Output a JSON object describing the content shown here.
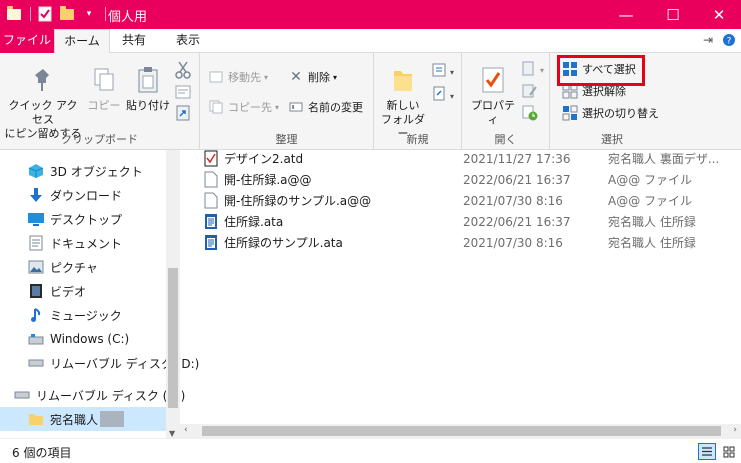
{
  "window": {
    "title": "個人用"
  },
  "quick_access": {
    "icons": [
      "folder-icon",
      "properties-check-icon",
      "new-folder-icon",
      "customize-dropdown-icon"
    ]
  },
  "title_buttons": {
    "minimize": "—",
    "maximize": "☐",
    "close": "✕"
  },
  "tabs": {
    "file": "ファイル",
    "home": "ホーム",
    "share": "共有",
    "view": "表示"
  },
  "ribbon": {
    "clipboard": {
      "label": "クリップボード",
      "pin_line1": "クイック アクセス",
      "pin_line2": "にピン留めする",
      "copy": "コピー",
      "paste": "貼り付け"
    },
    "organize": {
      "label": "整理",
      "move_to": "移動先",
      "copy_to": "コピー先",
      "delete": "削除",
      "rename": "名前の変更"
    },
    "new": {
      "label": "新規",
      "new_folder_line1": "新しい",
      "new_folder_line2": "フォルダー"
    },
    "open": {
      "label": "開く",
      "properties": "プロパティ"
    },
    "select": {
      "label": "選択",
      "select_all": "すべて選択",
      "select_none": "選択解除",
      "invert": "選択の切り替え"
    },
    "highlight_color": "#e6001a"
  },
  "nav": {
    "items": [
      {
        "label": "3D オブジェクト",
        "icon": "3d-objects-icon"
      },
      {
        "label": "ダウンロード",
        "icon": "download-icon"
      },
      {
        "label": "デスクトップ",
        "icon": "desktop-icon"
      },
      {
        "label": "ドキュメント",
        "icon": "documents-icon"
      },
      {
        "label": "ピクチャ",
        "icon": "pictures-icon"
      },
      {
        "label": "ビデオ",
        "icon": "video-icon"
      },
      {
        "label": "ミュージック",
        "icon": "music-icon"
      },
      {
        "label": "Windows (C:)",
        "icon": "windows-drive-icon"
      },
      {
        "label": "リムーバブル ディスク (D:)",
        "icon": "removable-drive-icon"
      },
      {
        "label": "リムーバブル ディスク (D:)",
        "icon": "removable-drive-icon"
      },
      {
        "label": "宛名職人",
        "icon": "folder-icon"
      }
    ]
  },
  "files": [
    {
      "name": "デザイン2.atd",
      "date": "2021/11/27 17:36",
      "type": "宛名職人 裏面デザ...",
      "icon": "atd-file-icon"
    },
    {
      "name": "開-住所録.a@@",
      "date": "2022/06/21 16:37",
      "type": "A@@ ファイル",
      "icon": "blank-file-icon"
    },
    {
      "name": "開-住所録のサンプル.a@@",
      "date": "2021/07/30 8:16",
      "type": "A@@ ファイル",
      "icon": "blank-file-icon"
    },
    {
      "name": "住所録.ata",
      "date": "2022/06/21 16:37",
      "type": "宛名職人 住所録",
      "icon": "ata-file-icon"
    },
    {
      "name": "住所録のサンプル.ata",
      "date": "2021/07/30 8:16",
      "type": "宛名職人 住所録",
      "icon": "ata-file-icon"
    }
  ],
  "status": {
    "item_count": "6 個の項目"
  },
  "colors": {
    "title_bar": "#e8005c",
    "selected_nav": "#cce8ff"
  }
}
